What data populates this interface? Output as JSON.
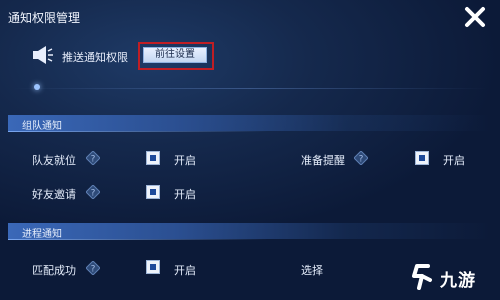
{
  "window": {
    "title": "通知权限管理"
  },
  "push": {
    "label": "推送通知权限",
    "goto_button": "前往设置"
  },
  "sections": [
    {
      "title": "组队通知"
    },
    {
      "title": "进程通知"
    }
  ],
  "items": [
    {
      "label": "队友就位",
      "state": "开启",
      "checked": true
    },
    {
      "label": "准备提醒",
      "state": "开启",
      "checked": true
    },
    {
      "label": "好友邀请",
      "state": "开启",
      "checked": true
    },
    {
      "label": "匹配成功",
      "state": "开启",
      "checked": true
    },
    {
      "label": "选择",
      "state": ""
    }
  ],
  "watermark": {
    "text": "九游"
  },
  "colors": {
    "highlight_border": "#c01e24",
    "accent": "#3a68b8"
  }
}
